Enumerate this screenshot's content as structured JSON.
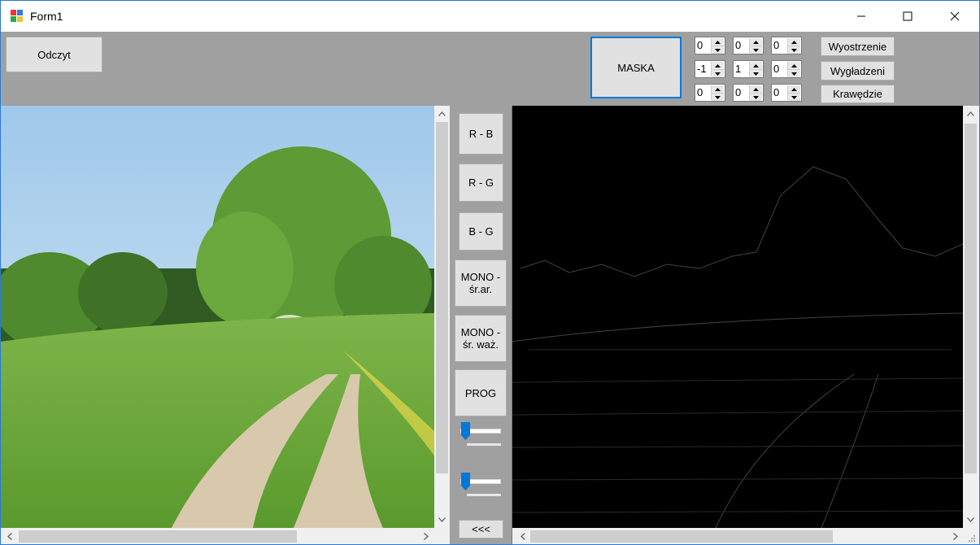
{
  "window": {
    "title": "Form1"
  },
  "toolbar": {
    "read_label": "Odczyt",
    "mask_label": "MASKA",
    "sharpen_label": "Wyostrzenie",
    "smooth_label": "Wygładzeni",
    "edges_label": "Krawędzie"
  },
  "mask": {
    "row1": [
      "0",
      "0",
      "0"
    ],
    "row2": [
      "-1",
      "1",
      "0"
    ],
    "row3": [
      "0",
      "0",
      "0"
    ]
  },
  "side": {
    "rb_label": "R - B",
    "rg_label": "R - G",
    "bg_label": "B - G",
    "mono_avg_line1": "MONO -",
    "mono_avg_line2": "śr.ar.",
    "mono_weighted_line1": "MONO -",
    "mono_weighted_line2": "śr. waż.",
    "threshold_label": "PROG",
    "copy_back_label": "<<<",
    "slider1_value": 0,
    "slider2_value": 0
  },
  "colors": {
    "accent": "#0078d7",
    "form_bg": "#a0a0a0",
    "button_bg": "#e1e1e1"
  }
}
